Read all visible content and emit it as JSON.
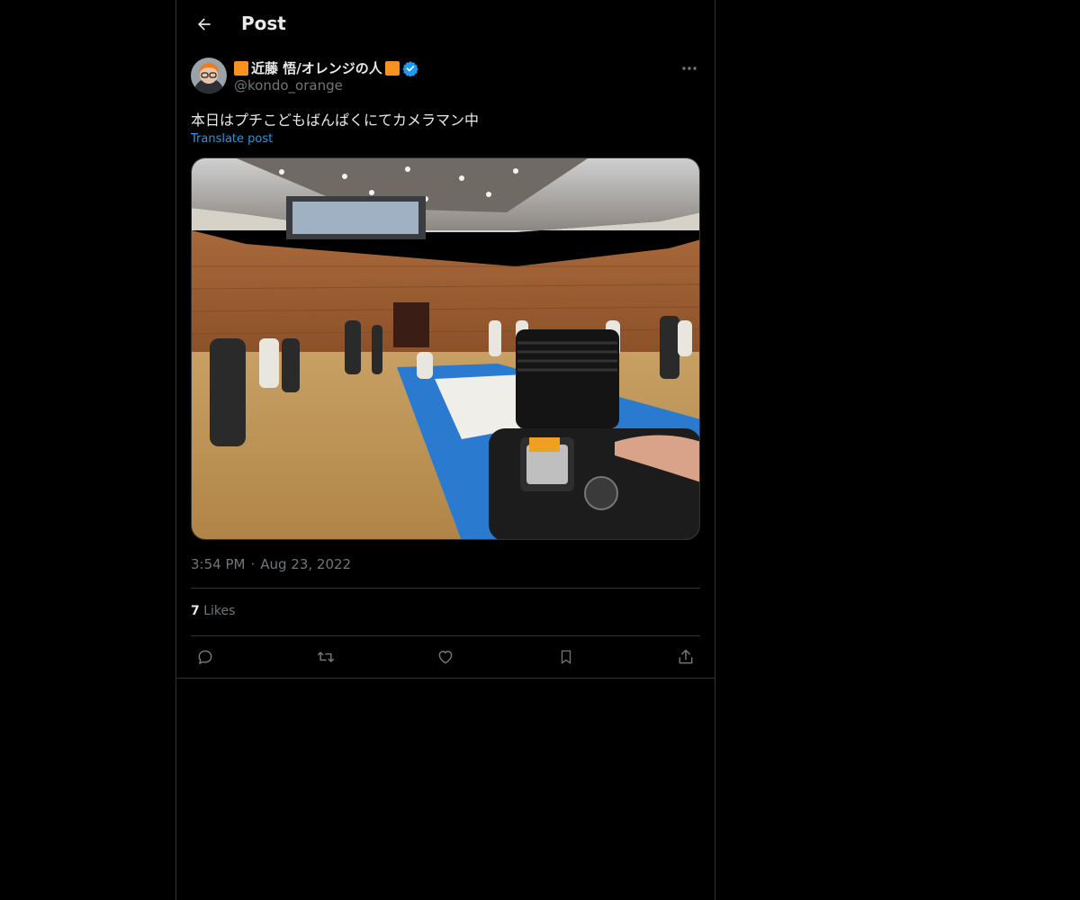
{
  "header": {
    "title": "Post"
  },
  "author": {
    "display_name": "近藤 悟/オレンジの人",
    "handle": "@kondo_orange"
  },
  "post": {
    "text": "本日はプチこどもばんぱくにてカメラマン中",
    "translate_label": "Translate post",
    "time": "3:54 PM",
    "separator": "·",
    "date": "Aug 23, 2022"
  },
  "stats": {
    "likes_count": "7",
    "likes_label": "Likes"
  },
  "icons": {
    "back": "arrow-left-icon",
    "verified": "verified-badge-icon",
    "more": "more-horizontal-icon",
    "reply": "reply-icon",
    "repost": "repost-icon",
    "like": "heart-icon",
    "bookmark": "bookmark-icon",
    "share": "share-icon"
  },
  "colors": {
    "background": "#000000",
    "text": "#e7e9ea",
    "secondary": "#71767b",
    "accent": "#1d9bf0",
    "border": "#2f3336"
  }
}
